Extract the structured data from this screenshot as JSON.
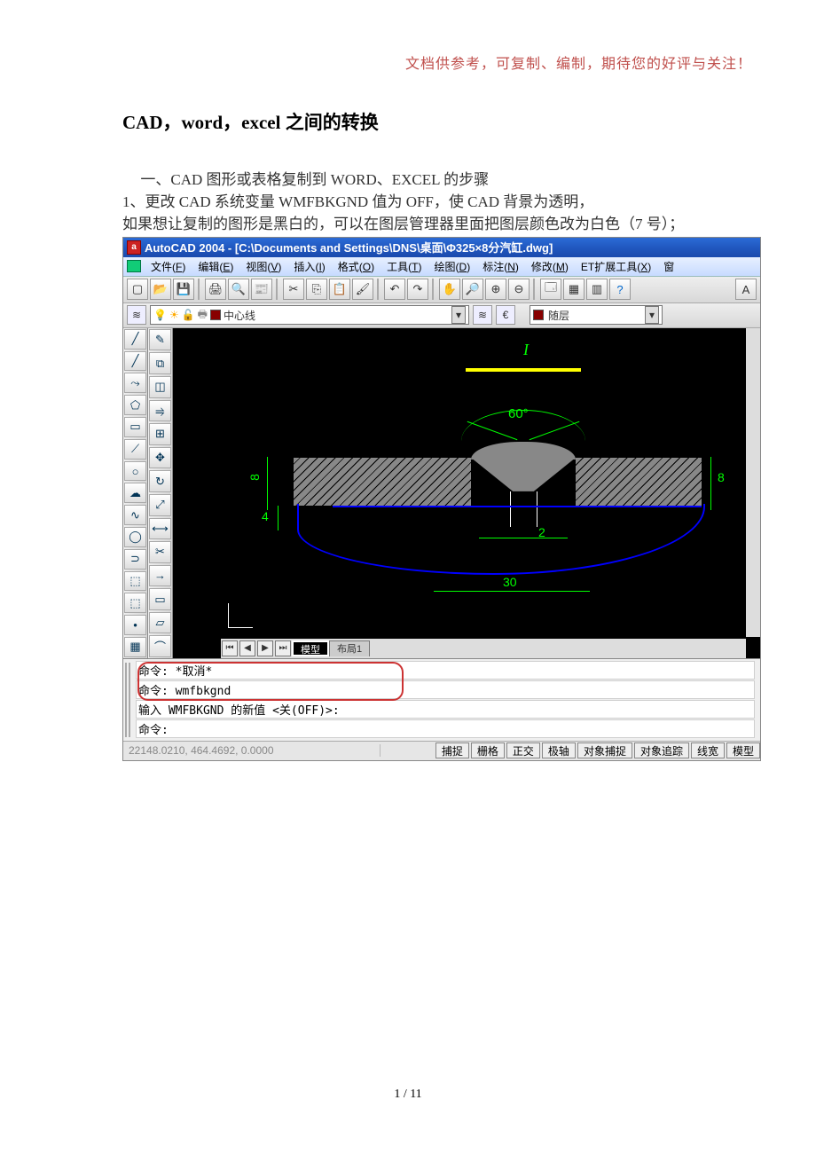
{
  "doc": {
    "header_note": "文档供参考，可复制、编制，期待您的好评与关注！",
    "title": "CAD，word，excel 之间的转换",
    "section1": "一、CAD 图形或表格复制到 WORD、EXCEL 的步骤",
    "p1": "1、更改 CAD 系统变量 WMFBKGND 值为 OFF，使 CAD 背景为透明，",
    "p2": "如果想让复制的图形是黑白的，可以在图层管理器里面把图层颜色改为白色（7 号）；",
    "page_num": "1 / 11"
  },
  "cad": {
    "titlebar": "AutoCAD 2004 - [C:\\Documents and Settings\\DNS\\桌面\\Φ325×8分汽缸.dwg]",
    "app_letter": "a",
    "menus": [
      {
        "label": "文件",
        "m": "F"
      },
      {
        "label": "编辑",
        "m": "E"
      },
      {
        "label": "视图",
        "m": "V"
      },
      {
        "label": "插入",
        "m": "I"
      },
      {
        "label": "格式",
        "m": "O"
      },
      {
        "label": "工具",
        "m": "T"
      },
      {
        "label": "绘图",
        "m": "D"
      },
      {
        "label": "标注",
        "m": "N"
      },
      {
        "label": "修改",
        "m": "M"
      },
      {
        "label": "ET扩展工具",
        "m": "X"
      },
      {
        "label": "窗",
        "m": ""
      }
    ],
    "layer_combo": "中心线",
    "color_combo": "随层",
    "tabs": {
      "active": "模型",
      "inactive": "布局1"
    },
    "cmd": {
      "l1": "命令: *取消*",
      "l2": "命令: wmfbkgnd",
      "l3": "输入 WMFBKGND 的新值 <关(OFF)>:",
      "l4": "命令:"
    },
    "status": {
      "coords": "22148.0210, 464.4692, 0.0000",
      "buttons": [
        "捕捉",
        "栅格",
        "正交",
        "极轴",
        "对象捕捉",
        "对象追踪",
        "线宽",
        "模型"
      ]
    },
    "dwg_labels": {
      "italic_i": "I",
      "angle": "60°",
      "dim8a": "8",
      "dim8b": "8",
      "dim4": "4",
      "dim2": "2",
      "dim30": "30"
    }
  }
}
